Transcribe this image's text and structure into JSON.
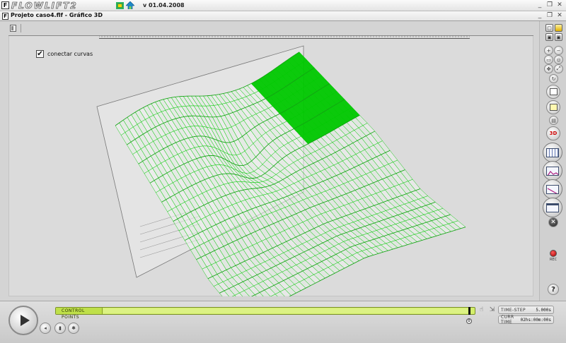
{
  "app": {
    "logo_text": "FLOWLIFT2",
    "version": "v 01.04.2008",
    "window_controls": [
      "_",
      "❐",
      "✕"
    ]
  },
  "document": {
    "title": "Projeto caso4.flf - Gráfico 3D",
    "window_controls": [
      "_",
      "❐",
      "✕"
    ]
  },
  "graph": {
    "connect_curves_label": "conectar curvas",
    "connect_curves_checked": true,
    "surface_color": "#00c800"
  },
  "sidebar": {
    "rec_label": "REC",
    "three_d_label": "3D",
    "help_label": "?"
  },
  "playback": {
    "control_points_label": "CONTROL POINTS",
    "slider_position_label": "0",
    "time_step_label": "TIME-STEP",
    "time_step_value": "5.000s",
    "curr_time_label": "CURR TIME",
    "curr_time_value": "02hs:00m:00s"
  },
  "colors": {
    "accent_green": "#00c800",
    "control_bar": "#d4ef6c",
    "rec_red": "#d00000"
  }
}
